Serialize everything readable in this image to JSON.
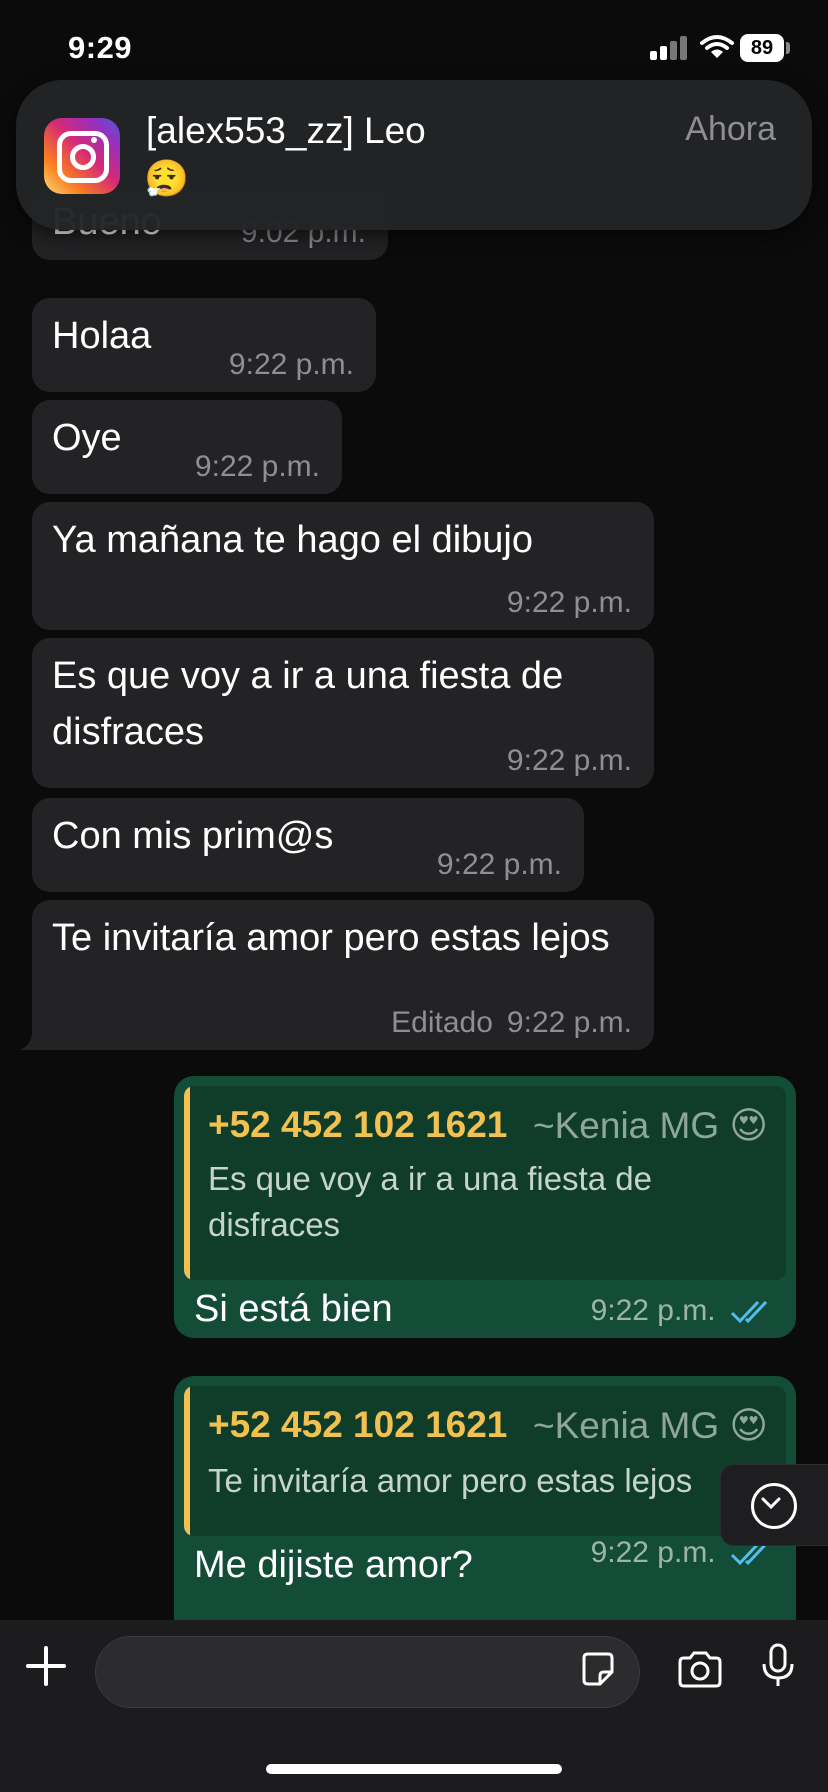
{
  "status": {
    "time": "9:29",
    "battery": "89"
  },
  "notification": {
    "sender": "[alex553_zz] Leo",
    "message": "😮‍💨",
    "time": "Ahora",
    "app_icon": "instagram-icon"
  },
  "incoming": [
    {
      "text": "Bueno",
      "time": "9:02 p.m."
    },
    {
      "text": "Holaa",
      "time": "9:22 p.m."
    },
    {
      "text": "Oye",
      "time": "9:22 p.m."
    },
    {
      "text": "Ya mañana te hago el dibujo",
      "time": "9:22 p.m."
    },
    {
      "text": "Es que voy a ir a una fiesta de disfraces",
      "time": "9:22 p.m."
    },
    {
      "text": "Con mis prim@s",
      "time": "9:22 p.m."
    },
    {
      "text": "Te invitaría amor pero estas lejos",
      "time": "9:22 p.m.",
      "edited": "Editado"
    }
  ],
  "outgoing": [
    {
      "quote_number": "+52 452 102 1621",
      "quote_contact": "~Kenia MG 😍",
      "quote_text": "Es que voy a ir a una fiesta de disfraces",
      "text": "Si está bien",
      "time": "9:22 p.m.",
      "status": "read"
    },
    {
      "quote_number": "+52 452 102 1621",
      "quote_contact": "~Kenia MG 😍",
      "quote_text": "Te invitaría amor pero estas lejos",
      "text": "Me dijiste amor?",
      "time": "9:22 p.m.",
      "status": "read"
    }
  ],
  "colors": {
    "incoming_bubble": "#232325",
    "outgoing_bubble": "#144d37",
    "quote_accent": "#f2c14f",
    "read_ticks": "#53bdeb"
  },
  "composer": {
    "value": "",
    "icons": [
      "plus-icon",
      "sticker-icon",
      "camera-icon",
      "microphone-icon"
    ]
  }
}
